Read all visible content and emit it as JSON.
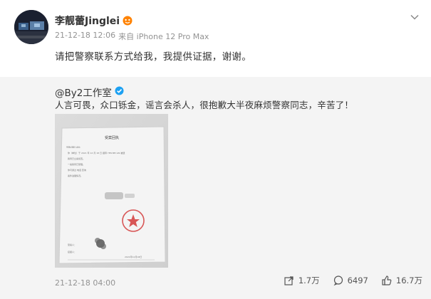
{
  "post": {
    "username": "李靓蕾Jinglei",
    "timestamp": "21-12-18 12:06",
    "source": "来自 iPhone 12 Pro Max",
    "text": "请把警察联系方式给我，我提供证据，谢谢。",
    "colors": {
      "accent": "#ff8200",
      "verified": "#1da1f2",
      "muted": "#939393"
    }
  },
  "retweet": {
    "username": "@By2工作室",
    "text": "人言可畏，众口铄金，谣言会杀人，很抱歉大半夜麻烦警察同志，辛苦了！",
    "timestamp": "21-12-18 04:00",
    "actions": {
      "share_count": "1.7万",
      "comment_count": "6497",
      "like_count": "16.7万"
    }
  },
  "document": {
    "title": "受案回执",
    "header_line": "YEN BEI LIN：",
    "body_line_1": "你（单位）于 2021 年 12 月 18 日 报称 YEN BEI LIN 被遗",
    "body_line_2": "我局已立案侦查。",
    "body_line_3": "一案我局已受理。",
    "body_line_4": "你可通过 电话 查询",
    "body_line_5": "案件进展情况。",
    "footer_line_1": "受案人：",
    "footer_line_2": "接报人：",
    "date": "2021年12月18日"
  }
}
